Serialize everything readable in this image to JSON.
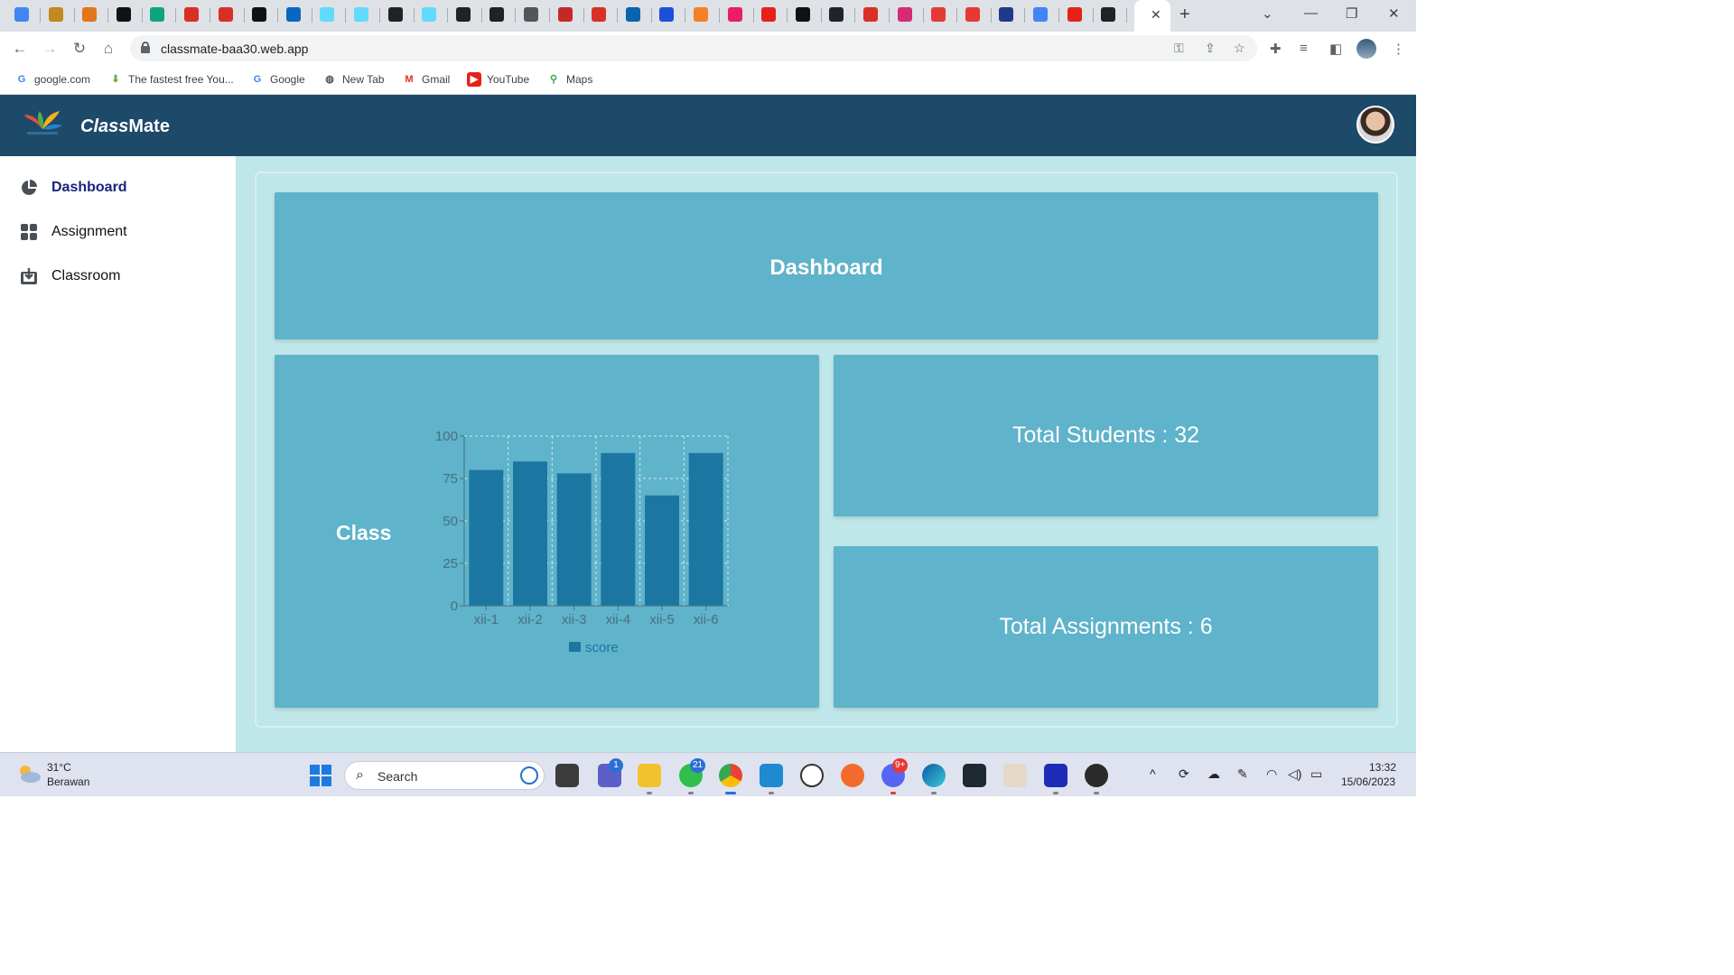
{
  "browser": {
    "address": "classmate-baa30.web.app",
    "bookmarks": [
      {
        "label": "google.com",
        "icon": "google-icon"
      },
      {
        "label": "The fastest free You...",
        "icon": "download-icon"
      },
      {
        "label": "Google",
        "icon": "google-icon"
      },
      {
        "label": "New Tab",
        "icon": "globe-icon"
      },
      {
        "label": "Gmail",
        "icon": "gmail-icon"
      },
      {
        "label": "YouTube",
        "icon": "youtube-icon"
      },
      {
        "label": "Maps",
        "icon": "maps-icon"
      }
    ]
  },
  "app": {
    "title_italic": "Class",
    "title_rest": "Mate",
    "nav": [
      {
        "label": "Dashboard",
        "icon": "pie-chart-icon",
        "active": true
      },
      {
        "label": "Assignment",
        "icon": "grid-icon",
        "active": false
      },
      {
        "label": "Classroom",
        "icon": "download-box-icon",
        "active": false
      }
    ],
    "header_card": "Dashboard",
    "class_card_label": "Class",
    "stats": {
      "total_students": "Total Students : 32",
      "total_assignments": "Total Assignments : 6"
    }
  },
  "chart_data": {
    "type": "bar",
    "categories": [
      "xii-1",
      "xii-2",
      "xii-3",
      "xii-4",
      "xii-5",
      "xii-6"
    ],
    "series": [
      {
        "name": "score",
        "values": [
          80,
          85,
          78,
          90,
          65,
          90
        ]
      }
    ],
    "ylim": [
      0,
      100
    ],
    "yticks": [
      0,
      25,
      50,
      75,
      100
    ],
    "grid": true,
    "legend": "bottom",
    "colors": {
      "bar": "#1b77a1",
      "axis": "#4a6f80",
      "grid": "#cfe9f2"
    }
  },
  "taskbar": {
    "temperature": "31°C",
    "condition": "Berawan",
    "search_placeholder": "Search",
    "time": "13:32",
    "date": "15/06/2023",
    "badges": {
      "teams": "1",
      "whatsapp": "21",
      "discord": "9+"
    }
  }
}
